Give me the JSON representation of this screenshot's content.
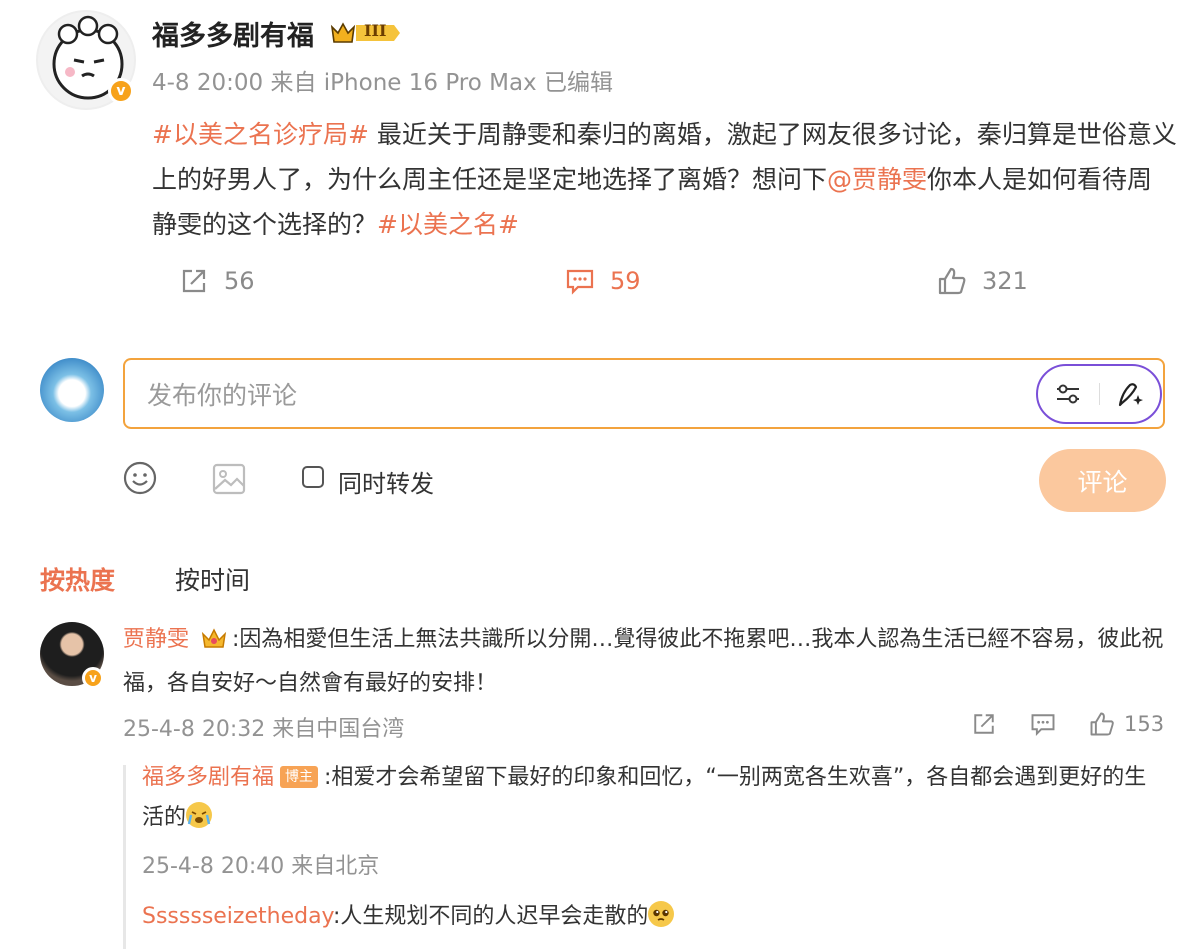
{
  "post": {
    "author": "福多多剧有福",
    "level_badge": "III",
    "time": "4-8 20:00",
    "source": "来自 iPhone 16 Pro Max",
    "edited": "已编辑",
    "content": {
      "topic1": "#以美之名诊疗局#",
      "text1": " 最近关于周静雯和秦归的离婚，激起了网友很多讨论，秦归算是世俗意义上的好男人了，为什么周主任还是坚定地选择了离婚？想问下",
      "mention": "@贾静雯",
      "text2": "你本人是如何看待周静雯的这个选择的？",
      "topic2": "#以美之名#"
    },
    "actions": {
      "repost": "56",
      "comment": "59",
      "like": "321"
    }
  },
  "composer": {
    "placeholder": "发布你的评论",
    "repost_label": "同时转发",
    "submit_label": "评论"
  },
  "sort": {
    "hot": "按热度",
    "time": "按时间"
  },
  "comments": [
    {
      "name": "贾静雯",
      "text": ":因為相愛但生活上無法共識所以分開…覺得彼此不拖累吧…我本人認為生活已經不容易，彼此祝福，各自安好～自然會有最好的安排！",
      "time": "25-4-8 20:32 来自中国台湾",
      "likes": "153",
      "replies": [
        {
          "name": "福多多剧有福",
          "tag": "博主",
          "text": ":相爱才会希望留下最好的印象和回忆，“一别两宽各生欢喜”，各自都会遇到更好的生活的",
          "time": "25-4-8 20:40 来自北京"
        },
        {
          "name": "Sssssseizetheday",
          "text": ":人生规划不同的人迟早会走散的"
        }
      ]
    }
  ],
  "colors": {
    "accent": "#eb7350",
    "input_border": "#f3a33d",
    "submit_bg": "#fbc89e",
    "ai_pill": "#7a4fd8"
  }
}
